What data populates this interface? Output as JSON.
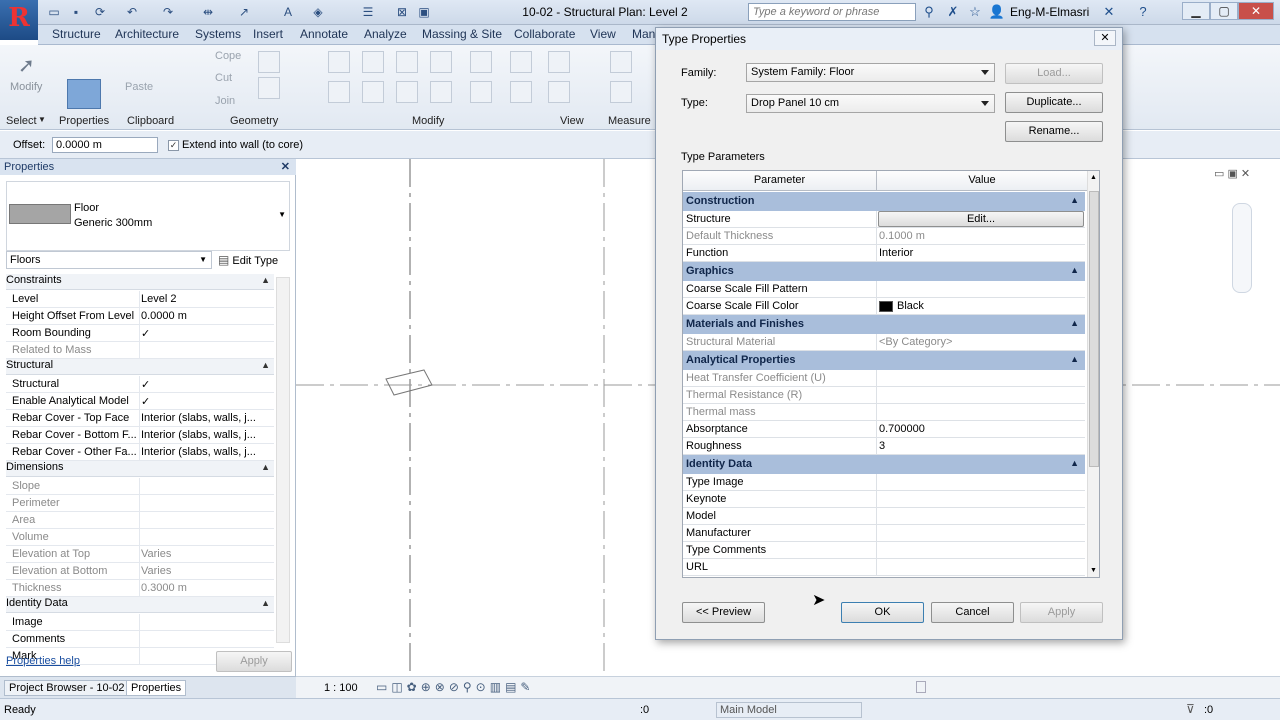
{
  "app": {
    "window_title": "10-02 - Structural Plan: Level 2",
    "search_placeholder": "Type a keyword or phrase",
    "user": "Eng-M-Elmasri",
    "logo_letter": "R"
  },
  "tabs": [
    "Structure",
    "Architecture",
    "Systems",
    "Insert",
    "Annotate",
    "Analyze",
    "Massing & Site",
    "Collaborate",
    "View",
    "Man"
  ],
  "ribbon": {
    "panels": [
      "Select",
      "Properties",
      "Clipboard",
      "Geometry",
      "Modify",
      "View",
      "Measure"
    ],
    "buttons": {
      "modify": "Modify",
      "paste": "Paste",
      "cope": "Cope",
      "cut": "Cut",
      "join": "Join",
      "properties": "Properties"
    }
  },
  "options_bar": {
    "offset_label": "Offset:",
    "offset_value": "0.0000 m",
    "extend_label": "Extend into wall (to core)",
    "extend_checked": true
  },
  "properties": {
    "title": "Properties",
    "type_family": "Floor",
    "type_name": "Generic 300mm",
    "category": "Floors",
    "edit_type": "Edit Type",
    "sections": [
      {
        "name": "Constraints",
        "rows": [
          {
            "p": "Level",
            "v": "Level 2",
            "grey": false
          },
          {
            "p": "Height Offset From Level",
            "v": "0.0000 m",
            "grey": false
          },
          {
            "p": "Room Bounding",
            "v": "✓",
            "grey": false
          },
          {
            "p": "Related to Mass",
            "v": "",
            "grey": true
          }
        ]
      },
      {
        "name": "Structural",
        "rows": [
          {
            "p": "Structural",
            "v": "✓",
            "grey": false
          },
          {
            "p": "Enable Analytical Model",
            "v": "✓",
            "grey": false
          },
          {
            "p": "Rebar Cover - Top Face",
            "v": "Interior (slabs, walls, j...",
            "grey": false
          },
          {
            "p": "Rebar Cover - Bottom F...",
            "v": "Interior (slabs, walls, j...",
            "grey": false
          },
          {
            "p": "Rebar Cover - Other Fa...",
            "v": "Interior (slabs, walls, j...",
            "grey": false
          }
        ]
      },
      {
        "name": "Dimensions",
        "rows": [
          {
            "p": "Slope",
            "v": "",
            "grey": true
          },
          {
            "p": "Perimeter",
            "v": "",
            "grey": true
          },
          {
            "p": "Area",
            "v": "",
            "grey": true
          },
          {
            "p": "Volume",
            "v": "",
            "grey": true
          },
          {
            "p": "Elevation at Top",
            "v": "Varies",
            "grey": true
          },
          {
            "p": "Elevation at Bottom",
            "v": "Varies",
            "grey": true
          },
          {
            "p": "Thickness",
            "v": "0.3000 m",
            "grey": true
          }
        ]
      },
      {
        "name": "Identity Data",
        "rows": [
          {
            "p": "Image",
            "v": "",
            "grey": false
          },
          {
            "p": "Comments",
            "v": "",
            "grey": false
          },
          {
            "p": "Mark",
            "v": "",
            "grey": false
          }
        ]
      }
    ],
    "help_link": "Properties help",
    "apply": "Apply"
  },
  "bottom_tabs": [
    "Project Browser - 10-02",
    "Properties"
  ],
  "view_bar": {
    "scale": "1 : 100"
  },
  "status": {
    "text": "Ready",
    "coord": ":0",
    "model": "Main Model",
    "filter": ":0"
  },
  "dialog": {
    "title": "Type Properties",
    "family_label": "Family:",
    "family_value": "System Family: Floor",
    "type_label": "Type:",
    "type_value": "Drop Panel 10 cm",
    "load": "Load...",
    "duplicate": "Duplicate...",
    "rename": "Rename...",
    "type_params_label": "Type Parameters",
    "col_param": "Parameter",
    "col_value": "Value",
    "sections": [
      {
        "name": "Construction",
        "rows": [
          {
            "p": "Structure",
            "v": "Edit...",
            "grey": false,
            "button": true
          },
          {
            "p": "Default Thickness",
            "v": "0.1000 m",
            "grey": true
          },
          {
            "p": "Function",
            "v": "Interior",
            "grey": false
          }
        ]
      },
      {
        "name": "Graphics",
        "rows": [
          {
            "p": "Coarse Scale Fill Pattern",
            "v": "",
            "grey": false
          },
          {
            "p": "Coarse Scale Fill Color",
            "v": "Black",
            "grey": false,
            "swatch": "#000000"
          }
        ]
      },
      {
        "name": "Materials and Finishes",
        "rows": [
          {
            "p": "Structural Material",
            "v": "<By Category>",
            "grey": true
          }
        ]
      },
      {
        "name": "Analytical Properties",
        "rows": [
          {
            "p": "Heat Transfer Coefficient (U)",
            "v": "",
            "grey": true
          },
          {
            "p": "Thermal Resistance (R)",
            "v": "",
            "grey": true
          },
          {
            "p": "Thermal mass",
            "v": "",
            "grey": true
          },
          {
            "p": "Absorptance",
            "v": "0.700000",
            "grey": false
          },
          {
            "p": "Roughness",
            "v": "3",
            "grey": false
          }
        ]
      },
      {
        "name": "Identity Data",
        "rows": [
          {
            "p": "Type Image",
            "v": "",
            "grey": false
          },
          {
            "p": "Keynote",
            "v": "",
            "grey": false
          },
          {
            "p": "Model",
            "v": "",
            "grey": false
          },
          {
            "p": "Manufacturer",
            "v": "",
            "grey": false
          },
          {
            "p": "Type Comments",
            "v": "",
            "grey": false
          },
          {
            "p": "URL",
            "v": "",
            "grey": false
          }
        ]
      }
    ],
    "preview": "<< Preview",
    "ok": "OK",
    "cancel": "Cancel",
    "apply": "Apply"
  },
  "colors": {
    "section_header": "#a9bedb",
    "accent": "#1d4b86"
  }
}
